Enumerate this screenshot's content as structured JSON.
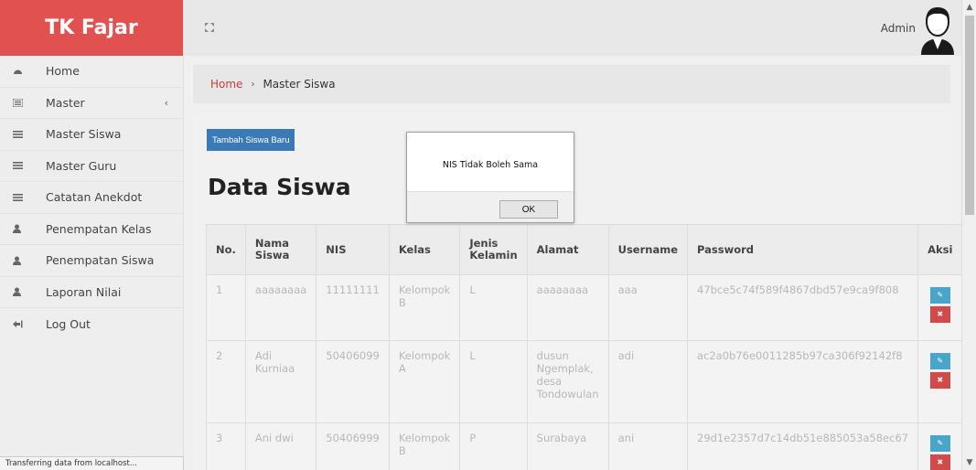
{
  "brand": "TK Fajar",
  "sidebar": {
    "items": [
      {
        "label": "Home",
        "icon": "dashboard-icon"
      },
      {
        "label": "Master",
        "icon": "list-icon",
        "chevron": "‹"
      },
      {
        "label": "Master Siswa",
        "icon": "list-icon"
      },
      {
        "label": "Master Guru",
        "icon": "list-icon"
      },
      {
        "label": "Catatan Anekdot",
        "icon": "list-icon"
      },
      {
        "label": "Penempatan Kelas",
        "icon": "user-icon"
      },
      {
        "label": "Penempatan Siswa",
        "icon": "user-icon"
      },
      {
        "label": "Laporan Nilai",
        "icon": "user-icon"
      },
      {
        "label": "Log Out",
        "icon": "logout-icon"
      }
    ]
  },
  "header": {
    "user": "Admin"
  },
  "breadcrumb": {
    "home": "Home",
    "separator": "›",
    "current": "Master Siswa"
  },
  "main": {
    "add_button": "Tambah Siswa Baru",
    "title": "Data Siswa"
  },
  "table": {
    "headers": [
      "No.",
      "Nama Siswa",
      "NIS",
      "Kelas",
      "Jenis Kelamin",
      "Alamat",
      "Username",
      "Password",
      "Aksi"
    ],
    "rows": [
      {
        "no": "1",
        "nama": "aaaaaaaa",
        "nis": "11111111",
        "kelas": "Kelompok B",
        "jk": "L",
        "alamat": "aaaaaaaa",
        "username": "aaa",
        "password": "47bce5c74f589f4867dbd57e9ca9f808"
      },
      {
        "no": "2",
        "nama": "Adi Kurniaa",
        "nis": "50406099",
        "kelas": "Kelompok A",
        "jk": "L",
        "alamat": "dusun Ngemplak, desa Tondowulan",
        "username": "adi",
        "password": "ac2a0b76e0011285b97ca306f92142f8"
      },
      {
        "no": "3",
        "nama": "Ani dwi",
        "nis": "50406999",
        "kelas": "Kelompok B",
        "jk": "P",
        "alamat": "Surabaya",
        "username": "ani",
        "password": "29d1e2357d7c14db51e885053a58ec67"
      }
    ]
  },
  "dialog": {
    "message": "NIS Tidak Boleh Sama",
    "ok_label": "OK"
  },
  "status_bar": "Transferring data from localhost...",
  "colors": {
    "brand": "#e0514f",
    "primary_button": "#3a7ab7",
    "edit_button": "#4aa6c9",
    "delete_button": "#d24a4a",
    "link": "#c0403d"
  }
}
